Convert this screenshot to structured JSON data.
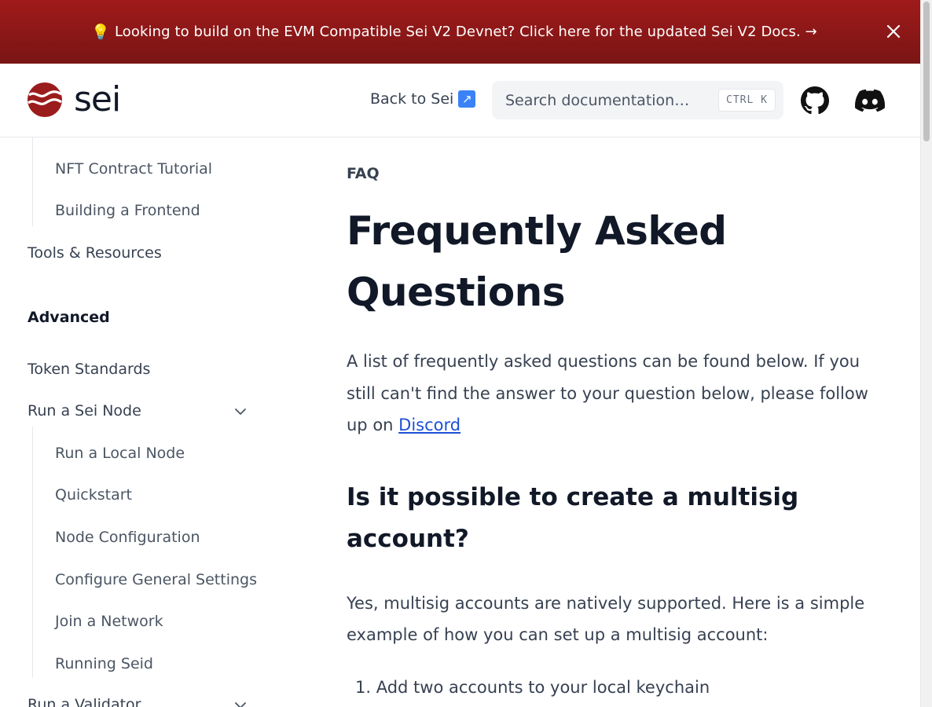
{
  "banner": {
    "icon": "lightbulb-icon",
    "bulb": "💡",
    "text": "Looking to build on the EVM Compatible Sei V2 Devnet? Click here for the updated Sei V2 Docs. →",
    "bg_color": "#8b1717"
  },
  "header": {
    "logo_text": "sei",
    "back_link": "Back to Sei",
    "back_arrow": "↗",
    "search_placeholder": "Search documentation…",
    "search_shortcut": "CTRL K"
  },
  "sidebar": {
    "items": [
      {
        "label": "NFT Contract Tutorial"
      },
      {
        "label": "Building a Frontend"
      },
      {
        "label": "Tools & Resources"
      },
      {
        "label": "Advanced"
      },
      {
        "label": "Token Standards"
      },
      {
        "label": "Run a Sei Node"
      },
      {
        "label": "Run a Local Node"
      },
      {
        "label": "Quickstart"
      },
      {
        "label": "Node Configuration"
      },
      {
        "label": "Configure General Settings"
      },
      {
        "label": "Join a Network"
      },
      {
        "label": "Running Seid"
      },
      {
        "label": "Run a Validator"
      }
    ]
  },
  "main": {
    "eyebrow": "FAQ",
    "title": "Frequently Asked Questions",
    "intro_text": "A list of frequently asked questions can be found below. If you still can't find the answer to your question below, please follow up on ",
    "intro_link": "Discord",
    "h2": "Is it possible to create a multisig account?",
    "para": "Yes, multisig accounts are natively supported. Here is a simple example of how you can set up a multisig account:",
    "list": [
      "1. Add two accounts to your local keychain"
    ]
  },
  "colors": {
    "brand": "#9b1c1c",
    "link": "#1d4ed8"
  }
}
